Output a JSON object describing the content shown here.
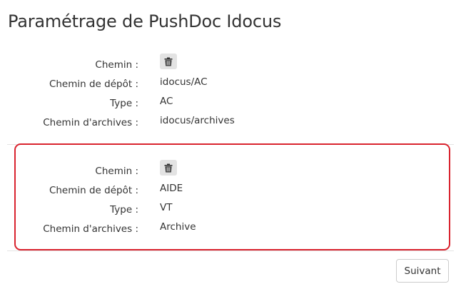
{
  "page": {
    "title": "Paramétrage de PushDoc Idocus"
  },
  "labels": {
    "path": "Chemin :",
    "deposit_path": "Chemin de dépôt :",
    "type": "Type :",
    "archive_path": "Chemin d'archives :"
  },
  "entries": [
    {
      "deposit_path": "idocus/AC",
      "type": "AC",
      "archive_path": "idocus/archives",
      "delete_icon": "trash-icon",
      "highlighted": false
    },
    {
      "deposit_path": "AIDE",
      "type": "VT",
      "archive_path": "Archive",
      "delete_icon": "trash-icon",
      "highlighted": true,
      "highlight_color": "#d9232e"
    }
  ],
  "footer": {
    "next_label": "Suivant"
  }
}
